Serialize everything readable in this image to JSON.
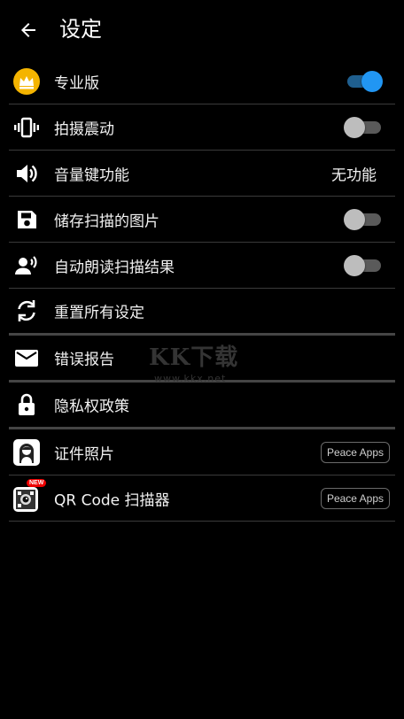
{
  "header": {
    "title": "设定",
    "back_icon": "arrow-left-icon"
  },
  "settings": [
    {
      "label": "专业版",
      "icon": "crown-icon",
      "control": "toggle",
      "on": true
    },
    {
      "label": "拍摄震动",
      "icon": "vibrate-icon",
      "control": "toggle",
      "on": false
    },
    {
      "label": "音量键功能",
      "icon": "volume-icon",
      "control": "value",
      "value": "无功能"
    },
    {
      "label": "储存扫描的图片",
      "icon": "save-icon",
      "control": "toggle",
      "on": false
    },
    {
      "label": "自动朗读扫描结果",
      "icon": "voice-icon",
      "control": "toggle",
      "on": false
    },
    {
      "label": "重置所有设定",
      "icon": "reset-icon"
    },
    {
      "label": "错误报告",
      "icon": "mail-icon"
    },
    {
      "label": "隐私权政策",
      "icon": "lock-icon"
    },
    {
      "label": "证件照片",
      "icon": "id-photo-app-icon",
      "button": "Peace Apps"
    },
    {
      "label": "QR Code 扫描器",
      "icon": "qr-scanner-app-icon",
      "button": "Peace Apps",
      "icon_badge": "NEW"
    }
  ],
  "watermark": {
    "text": "KK下载",
    "sub": "www.kkx.net"
  },
  "colors": {
    "accent": "#2196f3",
    "background": "#000000",
    "divider": "#3a3a3a"
  }
}
